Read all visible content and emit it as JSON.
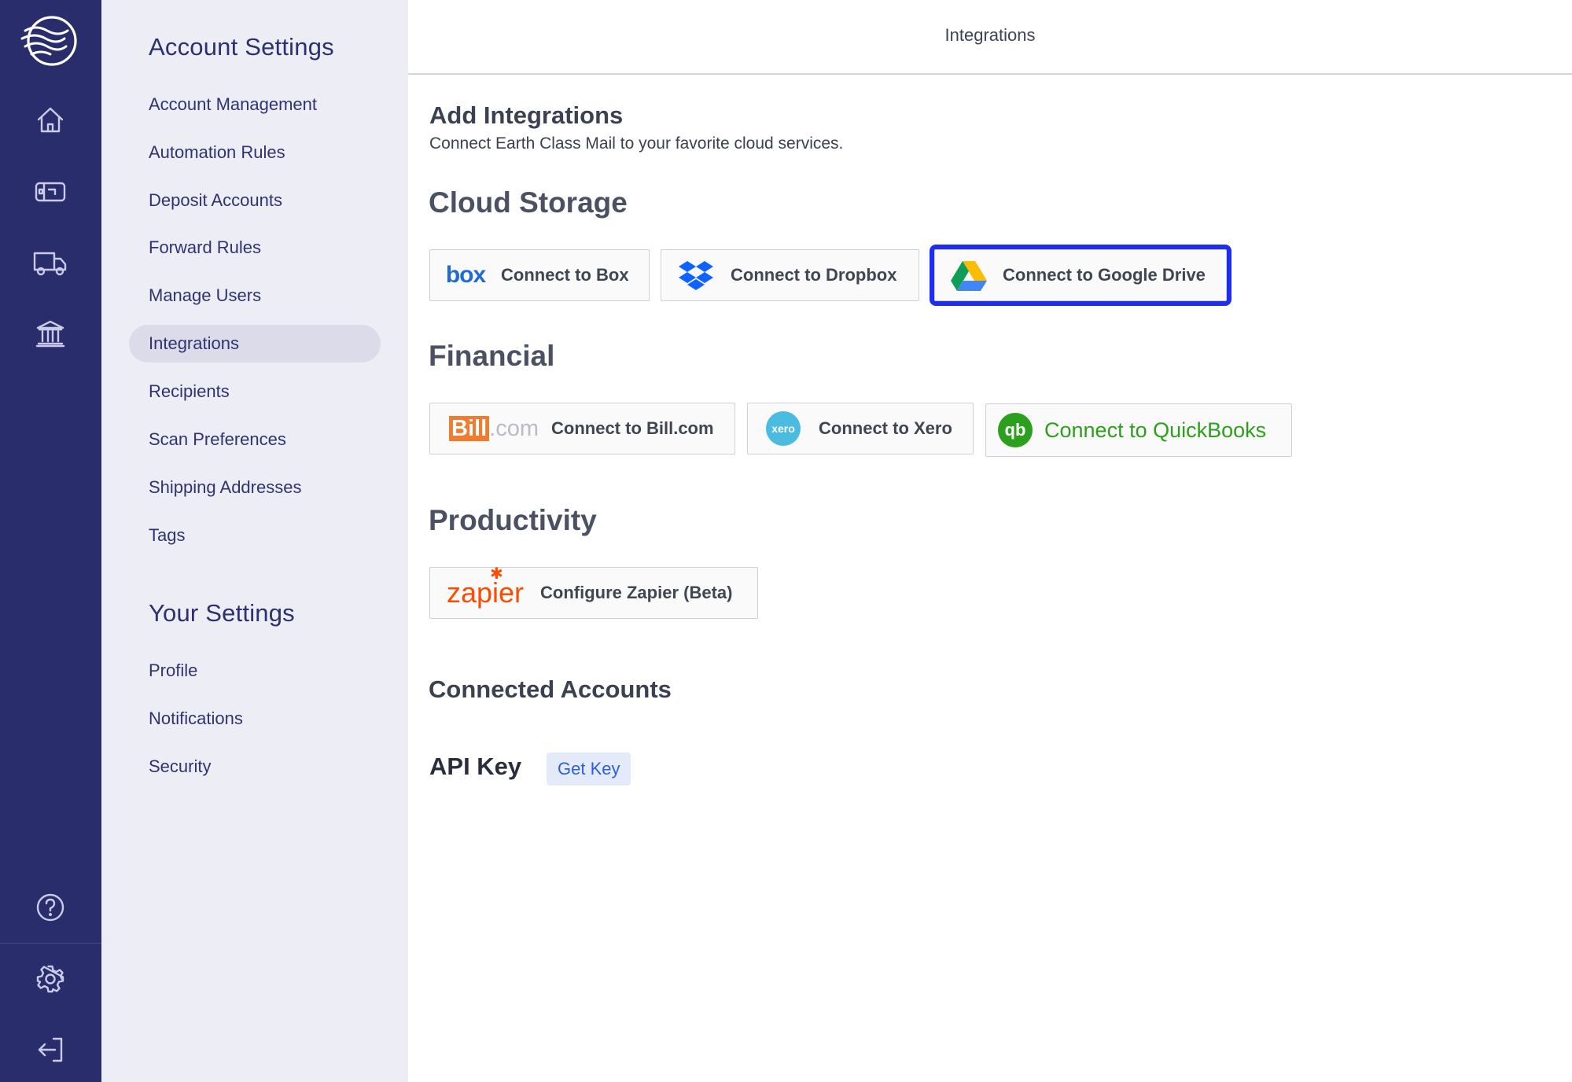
{
  "topbar": {
    "title": "Integrations"
  },
  "rail": {
    "icons": [
      "logo-icon",
      "home-icon",
      "mailbox-icon",
      "truck-icon",
      "bank-icon",
      "help-icon",
      "gear-icon",
      "logout-icon"
    ]
  },
  "sidebar": {
    "account_heading": "Account Settings",
    "account_items": [
      {
        "label": "Account Management"
      },
      {
        "label": "Automation Rules"
      },
      {
        "label": "Deposit Accounts"
      },
      {
        "label": "Forward Rules"
      },
      {
        "label": "Manage Users"
      },
      {
        "label": "Integrations"
      },
      {
        "label": "Recipients"
      },
      {
        "label": "Scan Preferences"
      },
      {
        "label": "Shipping Addresses"
      },
      {
        "label": "Tags"
      }
    ],
    "active_item": "Integrations",
    "your_heading": "Your Settings",
    "your_items": [
      {
        "label": "Profile"
      },
      {
        "label": "Notifications"
      },
      {
        "label": "Security"
      }
    ]
  },
  "main": {
    "add_title": "Add Integrations",
    "add_subtitle": "Connect Earth Class Mail to your favorite cloud services.",
    "cloud": {
      "heading": "Cloud Storage",
      "box_logo": "box",
      "box_label": "Connect to Box",
      "dropbox_label": "Connect to Dropbox",
      "gdrive_label": "Connect to Google Drive"
    },
    "financial": {
      "heading": "Financial",
      "bill_logo_a": "Bill",
      "bill_logo_b": ".com",
      "bill_label": "Connect to Bill.com",
      "xero_logo": "xero",
      "xero_label": "Connect to Xero",
      "qb_logo": "qb",
      "qb_label": "Connect to QuickBooks"
    },
    "productivity": {
      "heading": "Productivity",
      "zapier_logo": "zapier",
      "zapier_label": "Configure Zapier (Beta)"
    },
    "connected_heading": "Connected Accounts",
    "api_key_label": "API Key",
    "get_key_label": "Get Key"
  },
  "colors": {
    "rail_bg": "#2a2d6b",
    "sidebar_bg": "#ededf5",
    "focus_outline": "#1f2df0",
    "quickbooks_green": "#2ca01c",
    "get_key_text": "#2f5ed8"
  }
}
